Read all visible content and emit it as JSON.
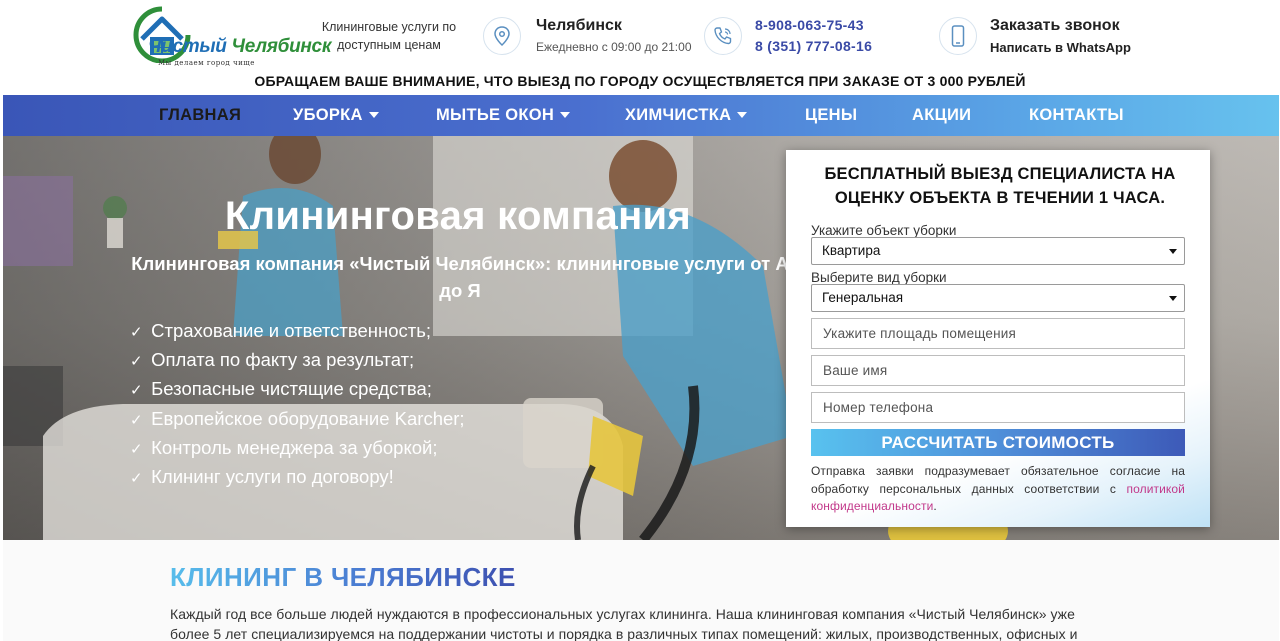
{
  "header": {
    "logo": {
      "brand": "Чистый Челябинск",
      "brand_first": "Чистый",
      "brand_second": "Челябинск",
      "tagline": "Мы делаем город чище"
    },
    "tagline": "Клининговые услуги по доступным ценам",
    "location": {
      "icon": "map-pin-icon",
      "city": "Челябинск",
      "hours": "Ежедневно с 09:00 до 21:00"
    },
    "phones": {
      "icon": "phone-icon",
      "phone1": "8-908-063-75-43",
      "phone2": "8 (351) 777-08-16"
    },
    "callback": {
      "icon": "smartphone-icon",
      "label": "Заказать звонок",
      "whatsapp": "Написать в WhatsApp"
    },
    "notice": "ОБРАЩАЕМ ВАШЕ ВНИМАНИЕ, ЧТО ВЫЕЗД ПО ГОРОДУ ОСУЩЕСТВЛЯЕТСЯ ПРИ ЗАКАЗЕ ОТ 3 000 РУБЛЕЙ"
  },
  "nav": {
    "items": [
      {
        "label": "ГЛАВНАЯ",
        "active": true,
        "dropdown": false
      },
      {
        "label": "УБОРКА",
        "active": false,
        "dropdown": true
      },
      {
        "label": "МЫТЬЕ ОКОН",
        "active": false,
        "dropdown": true
      },
      {
        "label": "ХИМЧИСТКА",
        "active": false,
        "dropdown": true
      },
      {
        "label": "ЦЕНЫ",
        "active": false,
        "dropdown": false
      },
      {
        "label": "АКЦИИ",
        "active": false,
        "dropdown": false
      },
      {
        "label": "КОНТАКТЫ",
        "active": false,
        "dropdown": false
      }
    ]
  },
  "hero": {
    "title": "Клининговая компания",
    "subtitle": "Клининговая компания «Чистый Челябинск»: клининговые услуги от А до Я",
    "bullet_icon": "check-icon",
    "bullets": [
      "Страхование и ответственность;",
      "Оплата по факту за результат;",
      "Безопасные чистящие средства;",
      "Европейское оборудование Karcher;",
      "Контроль менеджера за уборкой;",
      "Клининг услуги по договору!"
    ]
  },
  "form": {
    "title": "БЕСПЛАТНЫЙ ВЫЕЗД СПЕЦИАЛИСТА НА ОЦЕНКУ ОБЪЕКТА В ТЕЧЕНИИ 1 ЧАСА.",
    "object_label": "Укажите объект уборки",
    "object_value": "Квартира",
    "type_label": "Выберите вид уборки",
    "type_value": "Генеральная",
    "area_placeholder": "Укажите площадь помещения",
    "name_placeholder": "Ваше имя",
    "phone_placeholder": "Номер телефона",
    "submit": "РАССЧИТАТЬ СТОИМОСТЬ",
    "consent_text": "Отправка заявки подразумевает обязательное согласие на обработку персональных данных соответствии с ",
    "consent_link": "политикой конфиденциальности",
    "consent_end": "."
  },
  "section": {
    "title": "КЛИНИНГ В ЧЕЛЯБИНСКЕ",
    "text": "Каждый год все больше людей нуждаются в профессиональных услугах клининга. Наша клининговая компания «Чистый Челябинск» уже более 5 лет специализируемся на поддержании чистоты и порядка в различных типах помещений: жилых, производственных, офисных и"
  },
  "colors": {
    "brand_blue": "#3a4aa6",
    "accent_light": "#58c2ef",
    "link_pink": "#c2388a"
  }
}
